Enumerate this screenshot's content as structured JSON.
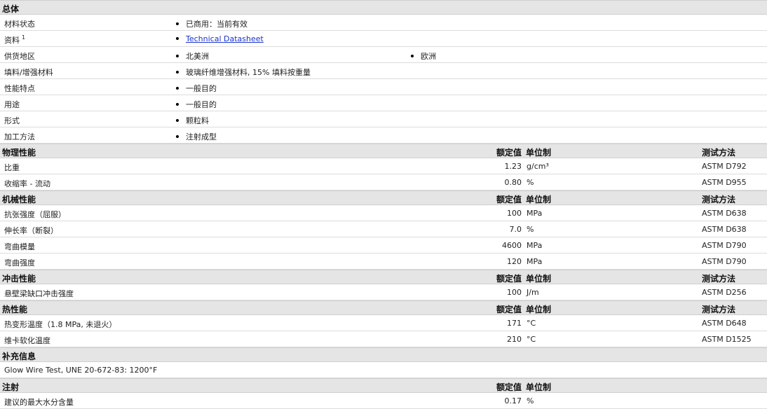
{
  "general": {
    "title": "总体",
    "rows": [
      {
        "label": "材料状态",
        "values": [
          "已商用：当前有效"
        ]
      },
      {
        "label": "资料",
        "sup": "1",
        "values": [
          "Technical Datasheet"
        ],
        "link": true
      },
      {
        "label": "供货地区",
        "values": [
          "北美洲",
          "欧洲"
        ]
      },
      {
        "label": "填料/增强材料",
        "values": [
          "玻璃纤维增强材料, 15% 填料按重量"
        ]
      },
      {
        "label": "性能特点",
        "values": [
          "一般目的"
        ]
      },
      {
        "label": "用途",
        "values": [
          "一般目的"
        ]
      },
      {
        "label": "形式",
        "values": [
          "颗粒料"
        ]
      },
      {
        "label": "加工方法",
        "values": [
          "注射成型"
        ]
      }
    ]
  },
  "col_headers": {
    "nominal": "额定值",
    "unit": "单位制",
    "method": "测试方法"
  },
  "physical": {
    "title": "物理性能",
    "rows": [
      {
        "label": "比重",
        "value": "1.23",
        "unit": "g/cm³",
        "method": "ASTM D792"
      },
      {
        "label": "收缩率 - 流动",
        "value": "0.80",
        "unit": "%",
        "method": "ASTM D955"
      }
    ]
  },
  "mechanical": {
    "title": "机械性能",
    "rows": [
      {
        "label": "抗张强度（屈服）",
        "value": "100",
        "unit": "MPa",
        "method": "ASTM D638"
      },
      {
        "label": "伸长率（断裂）",
        "value": "7.0",
        "unit": "%",
        "method": "ASTM D638"
      },
      {
        "label": "弯曲模量",
        "value": "4600",
        "unit": "MPa",
        "method": "ASTM D790"
      },
      {
        "label": "弯曲强度",
        "value": "120",
        "unit": "MPa",
        "method": "ASTM D790"
      }
    ]
  },
  "impact": {
    "title": "冲击性能",
    "rows": [
      {
        "label": "悬壁梁缺口冲击强度",
        "value": "100",
        "unit": "J/m",
        "method": "ASTM D256"
      }
    ]
  },
  "thermal": {
    "title": "热性能",
    "rows": [
      {
        "label": "热变形温度（1.8 MPa, 未退火）",
        "value": "171",
        "unit": "°C",
        "method": "ASTM D648"
      },
      {
        "label": "维卡软化温度",
        "value": "210",
        "unit": "°C",
        "method": "ASTM D1525"
      }
    ]
  },
  "supplemental": {
    "title": "补充信息",
    "text": "Glow Wire Test, UNE 20-672-83: 1200°F"
  },
  "injection": {
    "title": "注射",
    "rows": [
      {
        "label": "建议的最大水分含量",
        "value": "0.17",
        "unit": "%",
        "method": ""
      }
    ]
  }
}
